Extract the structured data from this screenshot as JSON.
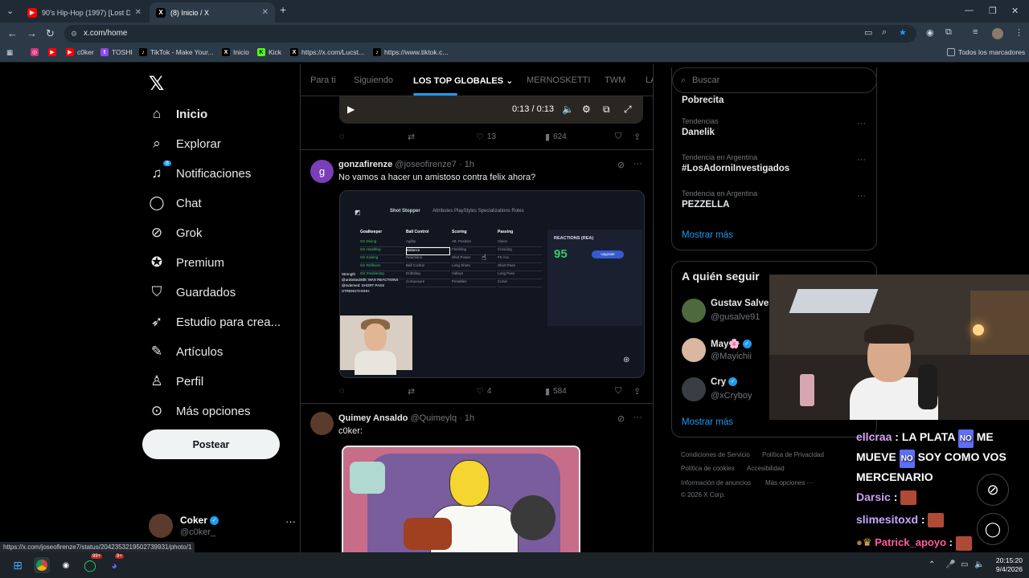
{
  "browser": {
    "tabs": [
      {
        "title": "90's Hip-Hop (1997) [Lost Demo",
        "favicon": "youtube-icon",
        "color": "#ff0000",
        "active": false
      },
      {
        "title": "(8) Inicio / X",
        "favicon": "x-icon",
        "color": "#000000",
        "active": true
      }
    ],
    "new_tab": "+",
    "address": "x.com/home",
    "bookmarks": [
      {
        "label": "",
        "icon": "instagram-icon"
      },
      {
        "label": "",
        "icon": "youtube-icon"
      },
      {
        "label": "c0ker",
        "icon": "youtube-icon"
      },
      {
        "label": "TOSHI",
        "icon": "twitch-icon"
      },
      {
        "label": "TikTok - Make Your...",
        "icon": "tiktok-icon"
      },
      {
        "label": "Inicio",
        "icon": "x-icon"
      },
      {
        "label": "Kick",
        "icon": "kick-icon"
      },
      {
        "label": "https://x.com/Lucst...",
        "icon": "x-icon"
      },
      {
        "label": "https://www.tiktok.c...",
        "icon": "tiktok-icon"
      }
    ],
    "all_bookmarks": "Todos los marcadores"
  },
  "nav": {
    "items": [
      {
        "label": "Inicio",
        "icon": "home-icon"
      },
      {
        "label": "Explorar",
        "icon": "search-icon"
      },
      {
        "label": "Notificaciones",
        "icon": "bell-icon",
        "badge": "8"
      },
      {
        "label": "Chat",
        "icon": "chat-icon"
      },
      {
        "label": "Grok",
        "icon": "grok-icon"
      },
      {
        "label": "Premium",
        "icon": "premium-icon"
      },
      {
        "label": "Guardados",
        "icon": "bookmark-icon"
      },
      {
        "label": "Estudio para crea...",
        "icon": "rocket-icon"
      },
      {
        "label": "Artículos",
        "icon": "article-icon"
      },
      {
        "label": "Perfil",
        "icon": "person-icon"
      },
      {
        "label": "Más opciones",
        "icon": "more-icon"
      }
    ],
    "post_button": "Postear",
    "profile": {
      "name": "Coker",
      "handle": "@c0ker_"
    }
  },
  "feed": {
    "tabs": [
      "Para ti",
      "Siguiendo",
      "LOS TOP GLOBALES",
      "MERNOSKETTI",
      "TWM",
      "LA"
    ],
    "video": {
      "time": "0:13 / 0:13"
    },
    "first_actions": {
      "likes": "13",
      "views": "624"
    },
    "posts": [
      {
        "name": "gonzafirenze",
        "handle": "@joseofirenze7",
        "time": "1h",
        "text": "No vamos a hacer un amistoso contra felix ahora?",
        "avatar_letter": "g",
        "likes": "4",
        "views": "584"
      },
      {
        "name": "Quimey Ansaldo",
        "handle": "@Quimeylq",
        "time": "1h",
        "text": "c0ker:"
      }
    ],
    "game": {
      "title": "Shot Stopper",
      "tabs": "Attributes   PlayStyles   Specializations   Roles",
      "columns": [
        {
          "h": "Goalkeeper",
          "rows": [
            "GK Diving",
            "GK Handling",
            "GK Kicking",
            "GK Reflexes",
            "GK Positioning"
          ]
        },
        {
          "h": "Ball Control",
          "rows": [
            "Agility",
            "Balance",
            "Reactions",
            "Ball Control",
            "Dribbling",
            "Composure"
          ]
        },
        {
          "h": "Scoring",
          "rows": [
            "Att. Position",
            "Finishing",
            "Shot Power",
            "Long Shots",
            "Volleys",
            "Penalties"
          ]
        },
        {
          "h": "Passing",
          "rows": [
            "Vision",
            "Crossing",
            "FK Acc.",
            "Short Pass",
            "Long Pass",
            "Curve"
          ]
        }
      ],
      "panel_title": "REACTIONS (REA)",
      "panel_value": "95",
      "upgrade": "Upgrade",
      "chat": [
        "Strength",
        "@unlimitedmilk: MAX REACTIONS",
        "@mdemed: SHORT PASS",
        "STRENGTHHHH"
      ]
    }
  },
  "right": {
    "search_placeholder": "Buscar",
    "trends": [
      {
        "cat": "",
        "title": "Pobrecita"
      },
      {
        "cat": "Tendencias",
        "title": "Danelik"
      },
      {
        "cat": "Tendencia en Argentina",
        "title": "#LosAdorniInvestigados"
      },
      {
        "cat": "Tendencia en Argentina",
        "title": "PEZZELLA"
      }
    ],
    "show_more": "Mostrar más",
    "who_to_follow_title": "A quién seguir",
    "follow": [
      {
        "name": "Gustav Salvest",
        "handle": "@gusalve91",
        "color": "#4d6a3f"
      },
      {
        "name": "May",
        "handle": "@Mayichii",
        "color": "#d9b7a2"
      },
      {
        "name": "Cry",
        "handle": "@xCryboy",
        "color": "#3a3d44"
      }
    ],
    "show_more_2": "Mostrar más",
    "footer": [
      "Condiciones de Servicio",
      "Política de Privacidad",
      "Política de cookies",
      "Accesibilidad",
      "Información de anuncios",
      "Más opciones ···",
      "© 2026 X Corp."
    ]
  },
  "stream": {
    "chat": [
      {
        "user": "ellcraa",
        "msg": "LA PLATA NO ME MUEVE NO SOY COMO VOS MERCENARIO"
      },
      {
        "user": "Darsic",
        "msg": ""
      },
      {
        "user": "slimesitoxd",
        "msg": ""
      },
      {
        "user": "Patrick_apoyo",
        "msg": ""
      }
    ]
  },
  "status_url": "https://x.com/joseofirenze7/status/2042353219502739931/photo/1",
  "taskbar": {
    "time": "20:15:20",
    "date": "9/4/2026",
    "badge_whatsapp": "99+",
    "badge_discord": "9+"
  }
}
